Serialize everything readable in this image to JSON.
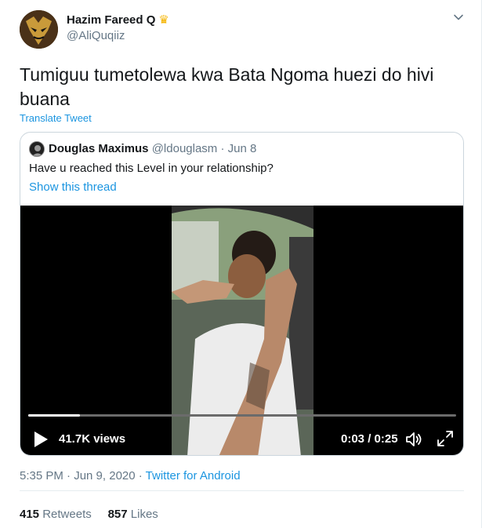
{
  "author": {
    "display_name": "Hazim Fareed Q",
    "handle": "@AliQuqiiz"
  },
  "tweet": {
    "text": "Tumiguu tumetolewa kwa Bata Ngoma huezi do hivi buana",
    "translate_label": "Translate Tweet"
  },
  "quoted": {
    "name": "Douglas Maximus",
    "handle": "@ldouglasm",
    "separator": "·",
    "date": "Jun 8",
    "text": "Have u reached this Level in your relationship?",
    "thread_link": "Show this thread"
  },
  "video": {
    "views": "41.7K views",
    "time": "0:03 / 0:25",
    "progress": 0.12
  },
  "meta": {
    "timestamp": "5:35 PM · Jun 9, 2020",
    "separator": "·",
    "source": "Twitter for Android"
  },
  "stats": {
    "retweets_count": "415",
    "retweets_label": "Retweets",
    "likes_count": "857",
    "likes_label": "Likes"
  },
  "colors": {
    "link": "#1b95e0",
    "secondary_text": "#657786",
    "primary_text": "#14171a"
  }
}
